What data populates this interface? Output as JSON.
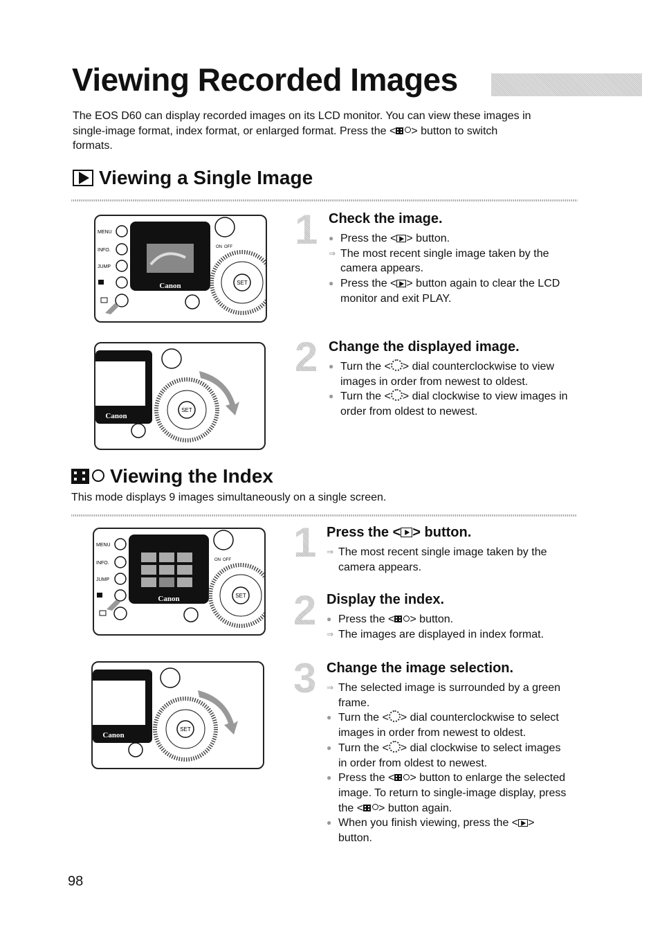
{
  "page": {
    "title": "Viewing Recorded Images",
    "intro": [
      "The EOS D60 can display recorded images on its LCD monitor. You can view these images in",
      "single-image format, index format, or enlarged format. Press the <",
      "> button to switch",
      "formats."
    ],
    "page_number": "98"
  },
  "section_single": {
    "heading": "Viewing a Single Image",
    "steps": [
      {
        "number": "1",
        "title": "Check the image.",
        "items": [
          {
            "marker": "bullet",
            "parts": [
              "Press the <",
              "> button."
            ]
          },
          {
            "marker": "arrow",
            "text": "The most recent single image taken by the camera appears."
          },
          {
            "marker": "bullet",
            "parts": [
              "Press the <",
              "> button again to clear the LCD monitor and exit PLAY."
            ]
          }
        ]
      },
      {
        "number": "2",
        "title": "Change the displayed image.",
        "items": [
          {
            "marker": "bullet",
            "parts": [
              "Turn the <",
              "> dial counterclockwise to view images in order from newest to oldest."
            ]
          },
          {
            "marker": "bullet",
            "parts": [
              "Turn the <",
              "> dial clockwise to view images in order from oldest to newest."
            ]
          }
        ]
      }
    ]
  },
  "section_index": {
    "heading": "Viewing the Index",
    "subtitle": "This mode displays 9 images simultaneously on a single screen.",
    "steps": [
      {
        "number": "1",
        "title_parts": [
          "Press the <",
          "> button."
        ],
        "items": [
          {
            "marker": "arrow",
            "text": "The most recent single image taken by the camera appears."
          }
        ]
      },
      {
        "number": "2",
        "title": "Display the index.",
        "items": [
          {
            "marker": "bullet",
            "parts": [
              "Press the <",
              "> button."
            ]
          },
          {
            "marker": "arrow",
            "text": "The images are displayed in index format."
          }
        ]
      },
      {
        "number": "3",
        "title": "Change the image selection.",
        "items": [
          {
            "marker": "arrow",
            "text": "The selected image is surrounded by a green frame."
          },
          {
            "marker": "bullet",
            "parts": [
              "Turn the <",
              "> dial counterclockwise to select images in order from newest to oldest."
            ]
          },
          {
            "marker": "bullet",
            "parts": [
              "Turn the <",
              "> dial clockwise to select images in order from oldest to newest."
            ]
          },
          {
            "marker": "bullet",
            "parts": [
              "Press the <",
              "> button to enlarge the selected image. To return to single-image display, press the <",
              "> button again."
            ]
          },
          {
            "marker": "bullet",
            "parts": [
              "When you finish viewing, press the <",
              "> button."
            ]
          }
        ]
      }
    ]
  },
  "camera_labels": {
    "menu": "MENU",
    "info": "INFO.",
    "jump": "JUMP",
    "brand": "Canon",
    "set": "SET",
    "on": "ON",
    "off": "OFF"
  },
  "markers": {
    "bullet": "●",
    "arrow": "⇒"
  }
}
